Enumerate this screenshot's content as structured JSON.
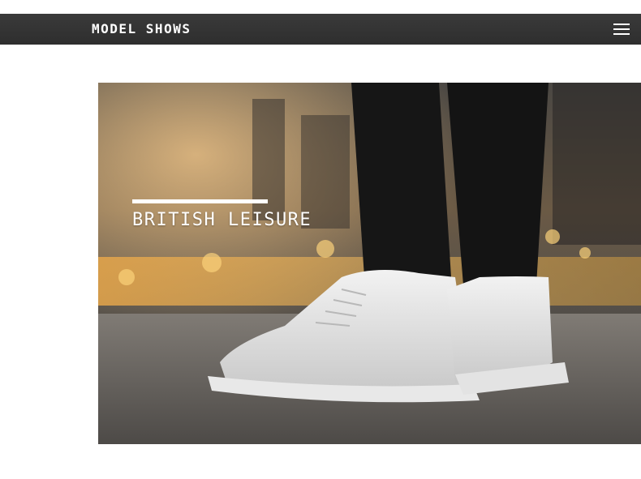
{
  "header": {
    "title": "MODEL SHOWS",
    "menu_icon": "hamburger-menu-icon"
  },
  "banner": {
    "caption": "BRITISH LEISURE",
    "image_subject": "white-high-top-sneakers-on-asphalt"
  },
  "colors": {
    "header_bg": "#333333",
    "header_text": "#ffffff",
    "caption_text": "#ffffff"
  }
}
